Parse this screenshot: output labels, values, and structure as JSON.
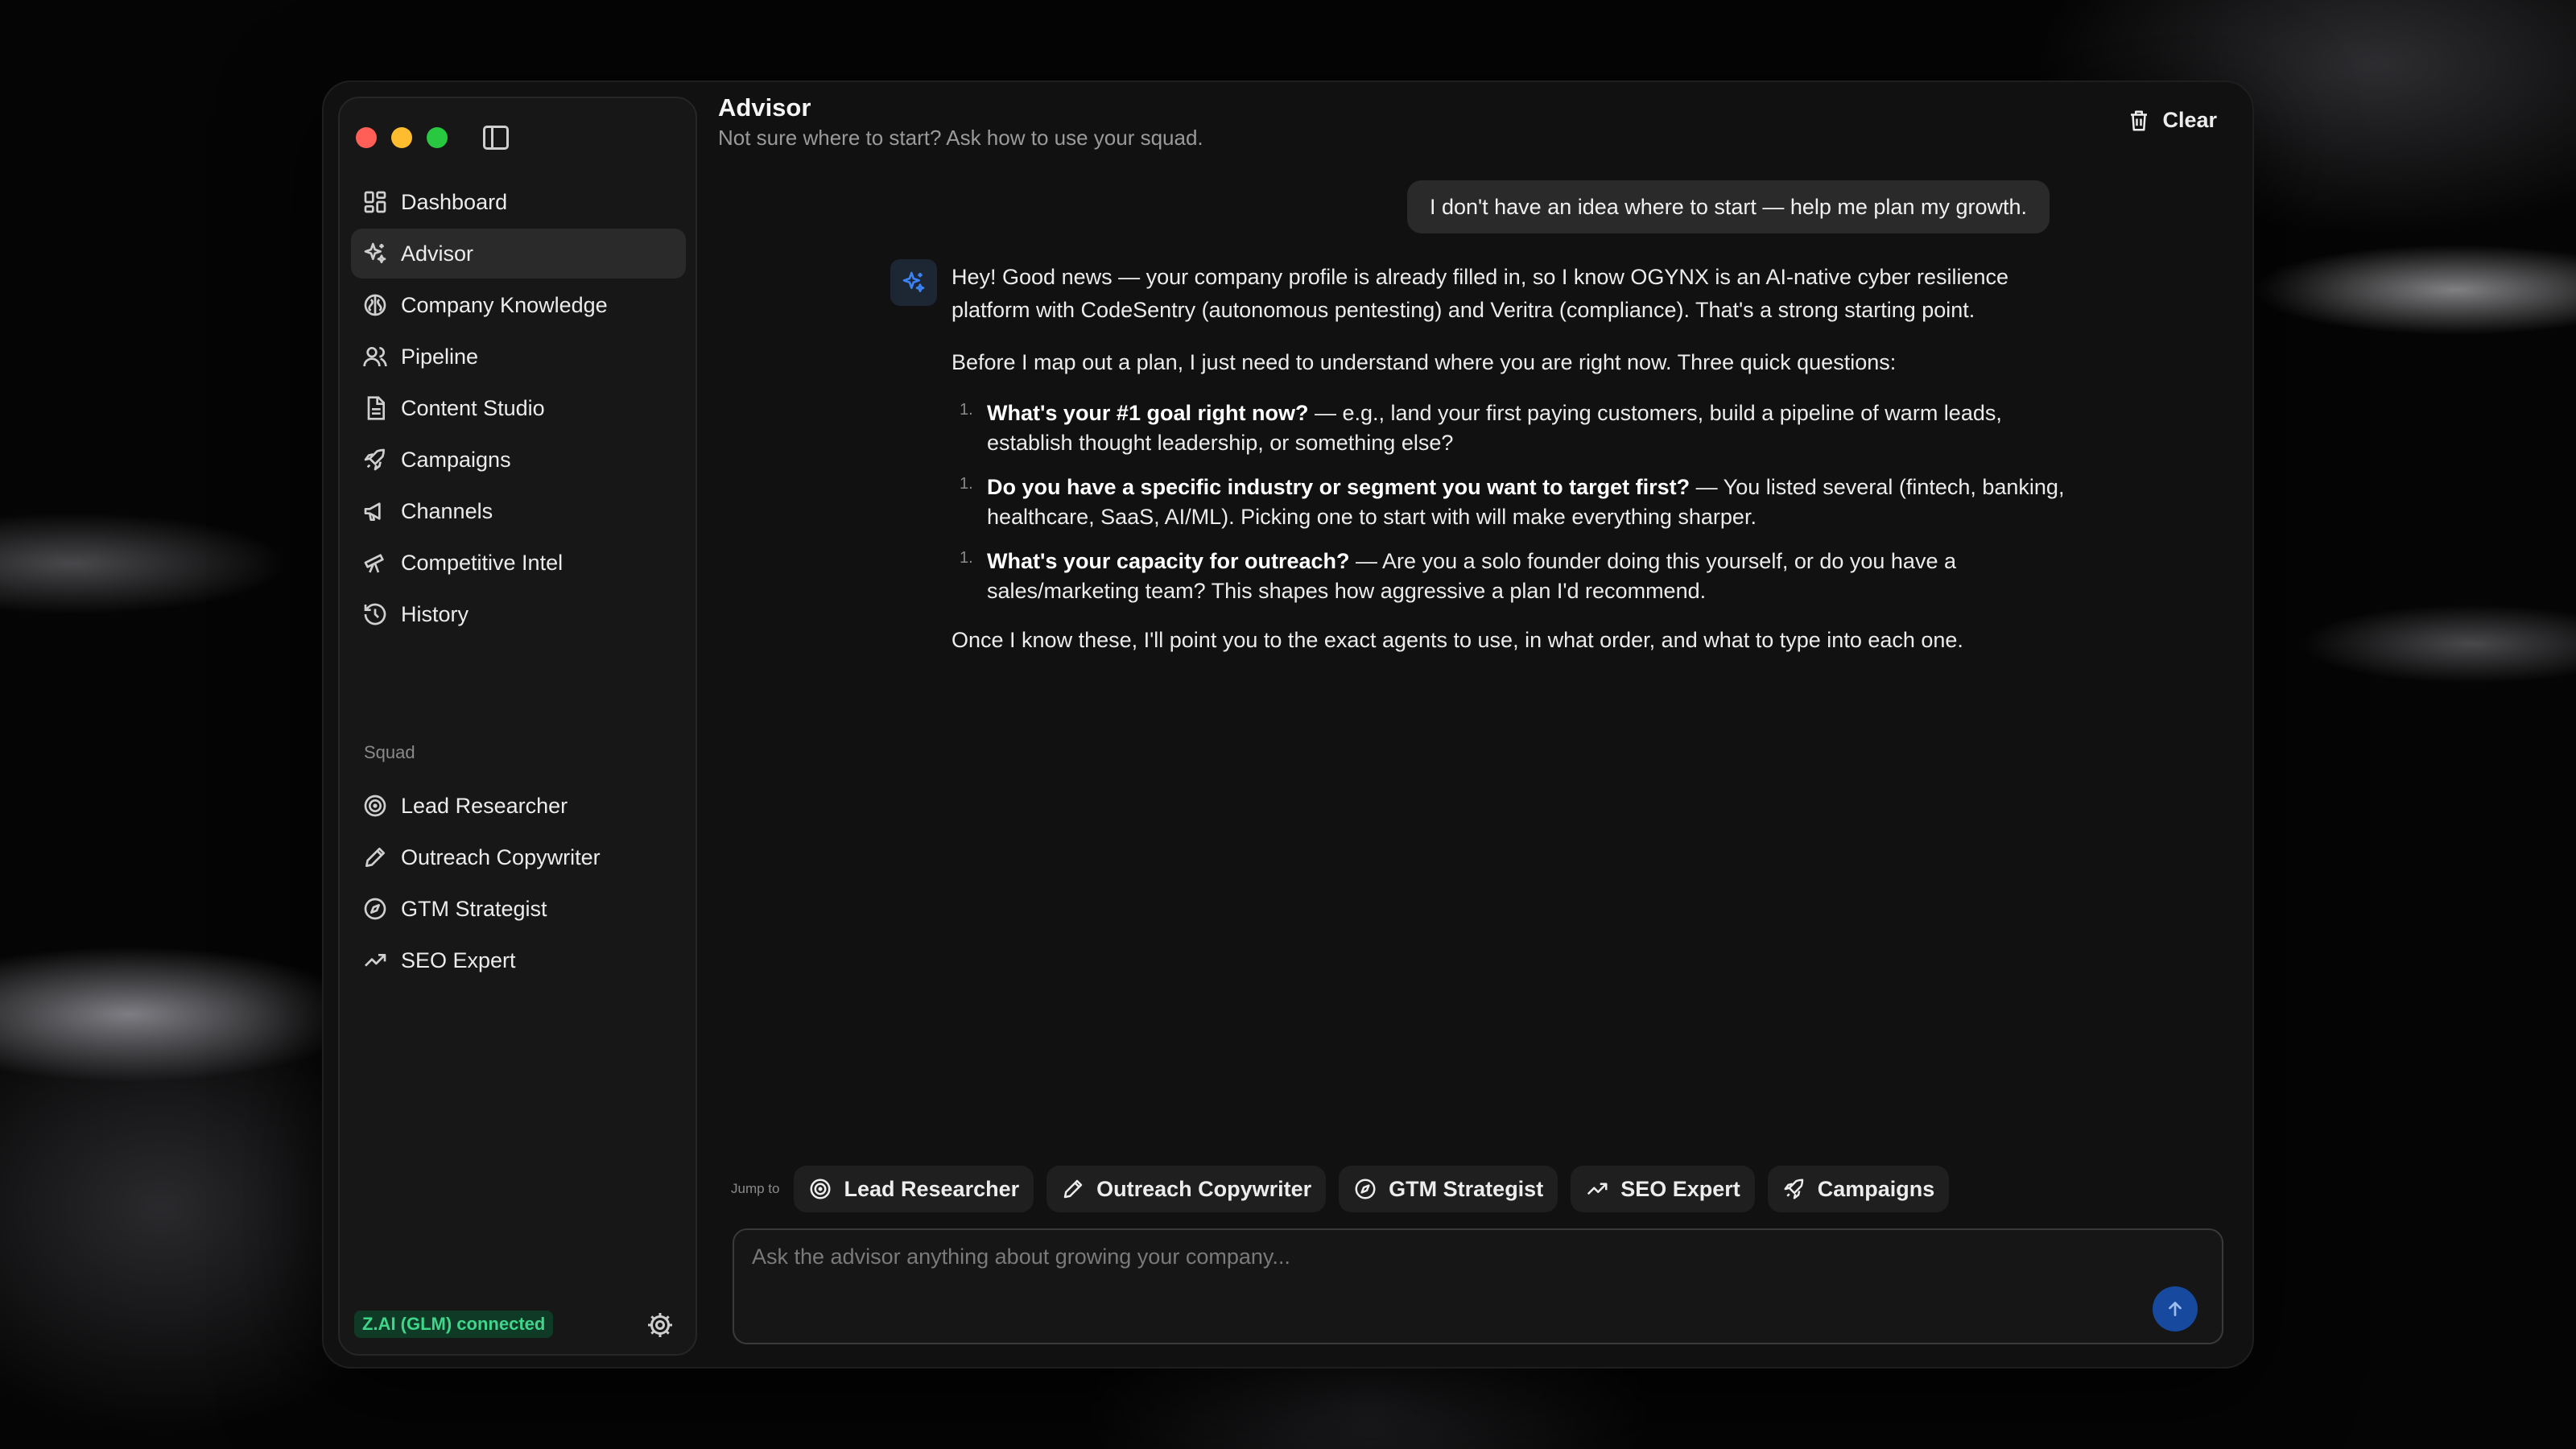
{
  "sidebar": {
    "nav": [
      {
        "label": "Dashboard",
        "icon": "dashboard-icon"
      },
      {
        "label": "Advisor",
        "icon": "sparkles-icon",
        "active": true
      },
      {
        "label": "Company Knowledge",
        "icon": "brain-icon"
      },
      {
        "label": "Pipeline",
        "icon": "users-icon"
      },
      {
        "label": "Content Studio",
        "icon": "document-icon"
      },
      {
        "label": "Campaigns",
        "icon": "rocket-icon"
      },
      {
        "label": "Channels",
        "icon": "megaphone-icon"
      },
      {
        "label": "Competitive Intel",
        "icon": "telescope-icon"
      },
      {
        "label": "History",
        "icon": "history-icon"
      }
    ],
    "section_label": "Squad",
    "squad": [
      {
        "label": "Lead Researcher",
        "icon": "target-icon"
      },
      {
        "label": "Outreach Copywriter",
        "icon": "pen-icon"
      },
      {
        "label": "GTM Strategist",
        "icon": "compass-icon"
      },
      {
        "label": "SEO Expert",
        "icon": "trending-up-icon"
      }
    ],
    "status_badge": "Z.AI (GLM) connected"
  },
  "header": {
    "title": "Advisor",
    "subtitle": "Not sure where to start? Ask how to use your squad.",
    "clear_label": "Clear"
  },
  "chat": {
    "user_message": "I don't have an idea where to start — help me plan my growth.",
    "assistant": {
      "intro": "Hey! Good news — your company profile is already filled in, so I know OGYNX is an AI-native cyber resilience platform with CodeSentry (autonomous pentesting) and Veritra (compliance). That's a strong starting point.",
      "lead": "Before I map out a plan, I just need to understand where you are right now. Three quick questions:",
      "questions": [
        {
          "num": "1.",
          "bold": "What's your #1 goal right now?",
          "rest": " — e.g., land your first paying customers, build a pipeline of warm leads, establish thought leadership, or something else?"
        },
        {
          "num": "1.",
          "bold": "Do you have a specific industry or segment you want to target first?",
          "rest": " — You listed several (fintech, banking, healthcare, SaaS, AI/ML). Picking one to start with will make everything sharper."
        },
        {
          "num": "1.",
          "bold": "What's your capacity for outreach?",
          "rest": " — Are you a solo founder doing this yourself, or do you have a sales/marketing team? This shapes how aggressive a plan I'd recommend."
        }
      ],
      "outro": "Once I know these, I'll point you to the exact agents to use, in what order, and what to type into each one."
    }
  },
  "jump": {
    "label": "Jump to",
    "chips": [
      {
        "label": "Lead Researcher",
        "icon": "target-icon"
      },
      {
        "label": "Outreach Copywriter",
        "icon": "pen-icon"
      },
      {
        "label": "GTM Strategist",
        "icon": "compass-icon"
      },
      {
        "label": "SEO Expert",
        "icon": "trending-up-icon"
      },
      {
        "label": "Campaigns",
        "icon": "rocket-icon"
      }
    ]
  },
  "composer": {
    "value": "",
    "placeholder": "Ask the advisor anything about growing your company..."
  },
  "colors": {
    "accent": "#174a9e",
    "status_green": "#3fd68b",
    "background": "#111111"
  }
}
